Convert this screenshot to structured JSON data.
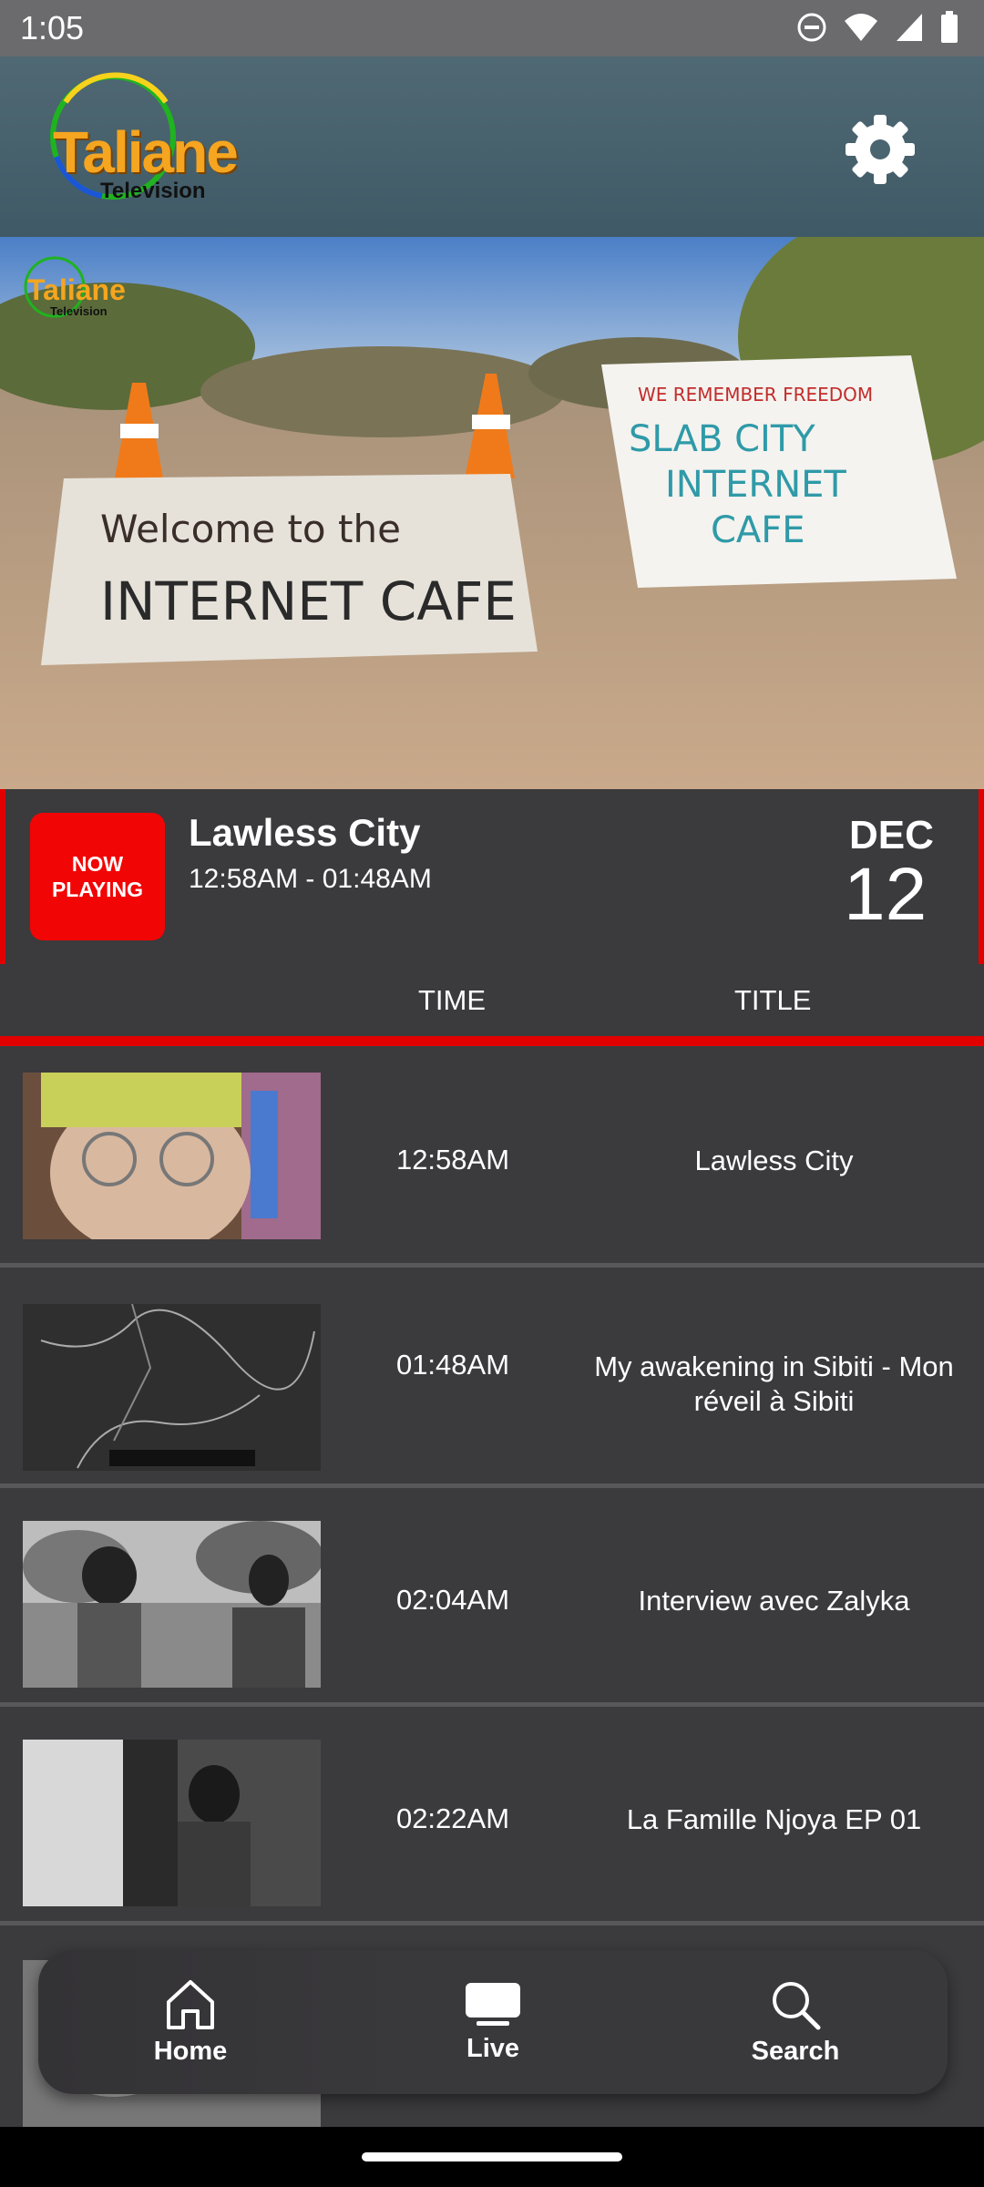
{
  "status_bar": {
    "time": "1:05"
  },
  "header": {
    "logo_main": "Taliane",
    "logo_sub": "Television"
  },
  "hero": {
    "watermark_main": "Taliane",
    "watermark_sub": "Television",
    "sign_left": "Welcome to the INTERNET CAFE",
    "sign_right_top": "WE REMEMBER FREEDOM",
    "sign_right_main": "SLAB CITY INTERNET CAFE"
  },
  "now_playing": {
    "badge_line1": "NOW",
    "badge_line2": "PLAYING",
    "title": "Lawless City",
    "time_range": "12:58AM - 01:48AM",
    "month": "DEC",
    "day": "12"
  },
  "schedule": {
    "col_time": "TIME",
    "col_title": "TITLE",
    "rows": [
      {
        "time": "12:58AM",
        "title": "Lawless City"
      },
      {
        "time": "01:48AM",
        "title": "My awakening in Sibiti - Mon réveil à Sibiti"
      },
      {
        "time": "02:04AM",
        "title": "Interview avec Zalyka"
      },
      {
        "time": "02:22AM",
        "title": "La Famille Njoya EP 01"
      }
    ]
  },
  "nav": {
    "home": "Home",
    "live": "Live",
    "search": "Search"
  },
  "colors": {
    "accent_red": "#e10000",
    "header_teal": "#4a6470",
    "background": "#3b3a3d"
  }
}
